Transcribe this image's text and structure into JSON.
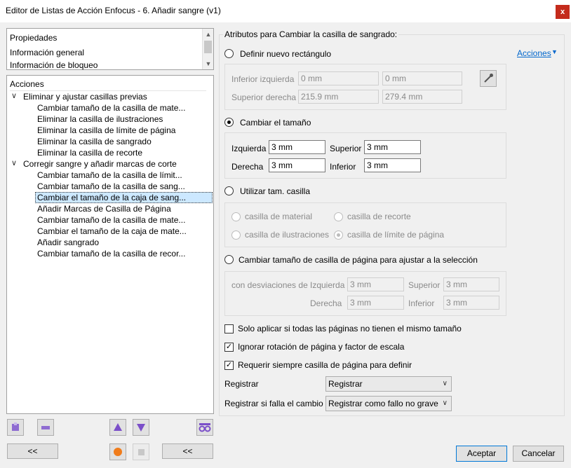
{
  "window": {
    "title": "Editor de Listas de Acción Enfocus - 6. Añadir sangre (v1)",
    "close": "x"
  },
  "properties": {
    "items": [
      "Propiedades",
      "Información general",
      "Información de bloqueo"
    ]
  },
  "actions_tree": {
    "header": "Acciones",
    "groups": [
      {
        "label": "Eliminar y ajustar casillas previas",
        "children": [
          "Cambiar tamaño de la casilla de mate...",
          "Eliminar la casilla de ilustraciones",
          "Eliminar la casilla de límite de página",
          "Eliminar la casilla de sangrado",
          "Eliminar la casilla de recorte"
        ]
      },
      {
        "label": "Corregir sangre y añadir marcas de corte",
        "children": [
          "Cambiar tamaño de la casilla de límit...",
          "Cambiar tamaño de la casilla de sang...",
          "Cambiar el tamaño de la caja de sang...",
          "Añadir Marcas de Casilla de Página",
          "Cambiar tamaño de la casilla de mate...",
          "Cambiar el tamaño de la caja de mate...",
          "Añadir sangrado",
          "Cambiar tamaño de la casilla de recor..."
        ]
      }
    ]
  },
  "bottom_left": {
    "back1": "<<",
    "back2": "<<"
  },
  "attrs": {
    "section_title": "Atributos para Cambiar la casilla de sangrado:",
    "acciones_link": "Acciones",
    "opt_new_rect": {
      "label": "Definir nuevo rectángulo",
      "lower_left_label": "Inferior izquierda",
      "lower_left_x": "0 mm",
      "lower_left_y": "0 mm",
      "upper_right_label": "Superior derecha",
      "upper_right_x": "215.9 mm",
      "upper_right_y": "279.4 mm"
    },
    "opt_resize": {
      "label": "Cambiar el tamaño",
      "left_label": "Izquierda",
      "left_value": "3 mm",
      "top_label": "Superior",
      "top_value": "3 mm",
      "right_label": "Derecha",
      "right_value": "3 mm",
      "bottom_label": "Inferior",
      "bottom_value": "3 mm"
    },
    "opt_box_size": {
      "label": "Utilizar tam. casilla",
      "media": "casilla de material",
      "trim": "casilla de recorte",
      "art": "casilla de ilustraciones",
      "bleed": "casilla de límite de página"
    },
    "opt_fit_selection": {
      "label": "Cambiar tamaño de casilla de página para ajustar a la selección",
      "offsets_label": "con desviaciones de",
      "left_label": "Izquierda",
      "left_value": "3 mm",
      "top_label": "Superior",
      "top_value": "3 mm",
      "right_label": "Derecha",
      "right_value": "3 mm",
      "bottom_label": "Inferior",
      "bottom_value": "3 mm"
    },
    "check_only_if": "Solo aplicar si todas las páginas no tienen el mismo tamaño",
    "check_ignore_rotation": "Ignorar rotación de página y factor de escala",
    "check_require_box": "Requerir siempre casilla de página para definir",
    "log_label": "Registrar",
    "log_value": "Registrar",
    "log_fail_label": "Registrar si falla el cambio",
    "log_fail_value": "Registrar como fallo no grave"
  },
  "footer": {
    "ok": "Aceptar",
    "cancel": "Cancelar"
  }
}
